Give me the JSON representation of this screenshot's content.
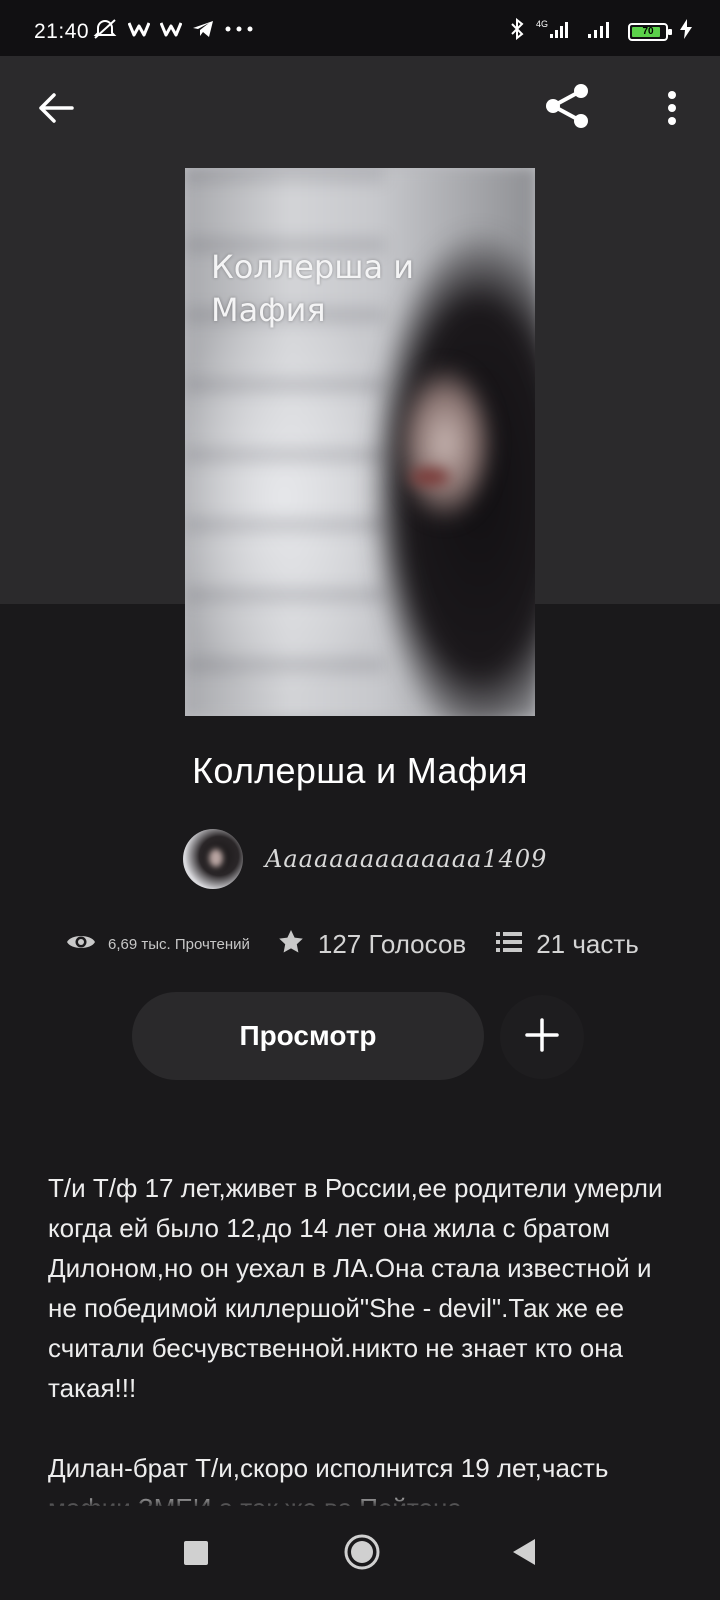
{
  "status_bar": {
    "time": "21:40",
    "left_icons": [
      "alarm-off-icon",
      "w-app-icon",
      "w-app-icon",
      "telegram-icon",
      "more-dots-icon"
    ],
    "right_icons": [
      "bluetooth-icon",
      "signal-4g-icon",
      "signal-icon",
      "battery-icon",
      "charging-icon"
    ],
    "battery_level": "70"
  },
  "topbar": {
    "back_icon": "arrow-left-icon",
    "share_icon": "share-icon",
    "more_icon": "more-vertical-icon"
  },
  "cover": {
    "title": "Коллерша и Мафия"
  },
  "story": {
    "title": "Коллерша и Мафия",
    "author": "Aaaaaaaaaaaaaa1409"
  },
  "stats": {
    "reads": "6,69 тыс. Прочтений",
    "votes": "127 Голосов",
    "parts": "21 часть"
  },
  "actions": {
    "read_label": "Просмотр",
    "add_icon": "plus-icon"
  },
  "description": "Т/и Т/ф 17 лет,живет в России,ее родители умерли когда ей было 12,до 14 лет она жила с братом Дилоном,но он уехал в ЛА.Она стала известной и не победимой киллершой\"She - devil\".Так же ее считали бесчувственной.никто не знает кто она такая!!!\n\nДилан-брат Т/и,скоро исполнится 19 лет,часть мафии ЗМЕИ а так же ва Пейтона",
  "navbar": {
    "recent_icon": "square-icon",
    "home_icon": "circle-icon",
    "back_icon": "triangle-back-icon"
  }
}
